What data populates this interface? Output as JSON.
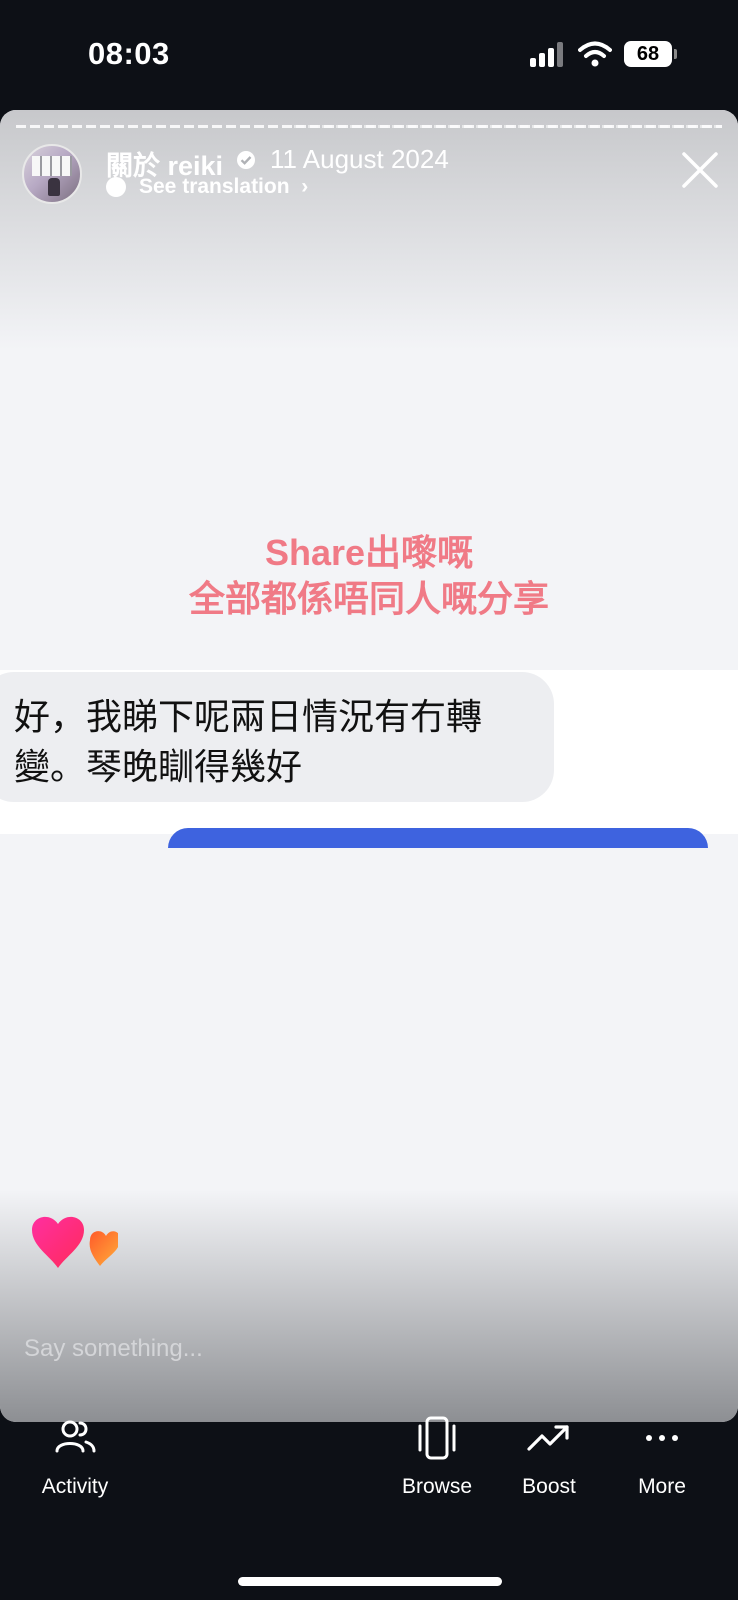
{
  "status_bar": {
    "time": "08:03",
    "battery": "68"
  },
  "story": {
    "page_name": "關於 reiki",
    "date": "11 August 2024",
    "see_translation": "See translation",
    "caption_lines": [
      "Share出嚟嘅",
      "全部都係唔同人嘅分享"
    ],
    "message_text": "好，我睇下呢兩日情況有冇轉變。琴晚瞓得幾好",
    "comment_placeholder": "Say something..."
  },
  "toolbar": {
    "items": [
      {
        "label": "Activity",
        "icon": "people-icon"
      },
      {
        "label": "Browse",
        "icon": "phone-frame-icon"
      },
      {
        "label": "Boost",
        "icon": "trend-up-icon"
      },
      {
        "label": "More",
        "icon": "more-dots-icon"
      }
    ]
  },
  "colors": {
    "caption": "#f07a86",
    "background": "#0d1016",
    "story_bg": "#f3f4f7",
    "reply_bubble": "#3e63df"
  }
}
